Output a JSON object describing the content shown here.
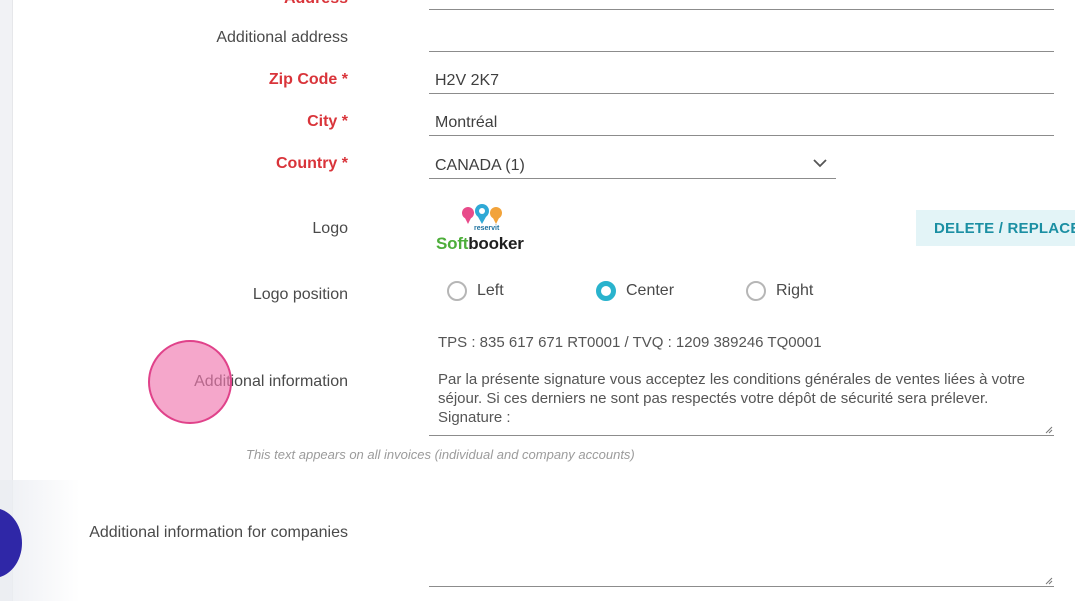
{
  "form": {
    "address_label": "Address",
    "address_value": "",
    "additional_address_label": "Additional address",
    "additional_address_value": "",
    "zip_label": "Zip Code *",
    "zip_value": "H2V 2K7",
    "city_label": "City *",
    "city_value": "Montréal",
    "country_label": "Country *",
    "country_value": "CANADA (1)",
    "logo_label": "Logo",
    "logo_brand_prefix": "Soft",
    "logo_brand_suffix": "booker",
    "logo_sub": "reservit",
    "delete_replace_label": "DELETE / REPLACE",
    "logo_position_label": "Logo position",
    "logo_position_options": [
      "Left",
      "Center",
      "Right"
    ],
    "logo_position_selected": "Center",
    "additional_info_label": "Additional information",
    "additional_info_line1": "TPS : 835 617 671 RT0001 / TVQ : 1209 389246 TQ0001",
    "additional_info_line2": "Par la présente signature vous acceptez les conditions générales de ventes liées à votre séjour. Si ces derniers ne sont pas respectés votre dépôt de sécurité sera prélever.",
    "additional_info_line3": "Signature :",
    "additional_info_hint": "This text appears on all invoices (individual and company accounts)",
    "additional_info_companies_label": "Additional information for companies",
    "additional_info_companies_value": ""
  },
  "colors": {
    "required_label": "#d9343a",
    "accent": "#29b3cd",
    "button_bg": "#e3f4f7",
    "button_text": "#1b8fa3",
    "tap_indicator": "#f078af"
  }
}
